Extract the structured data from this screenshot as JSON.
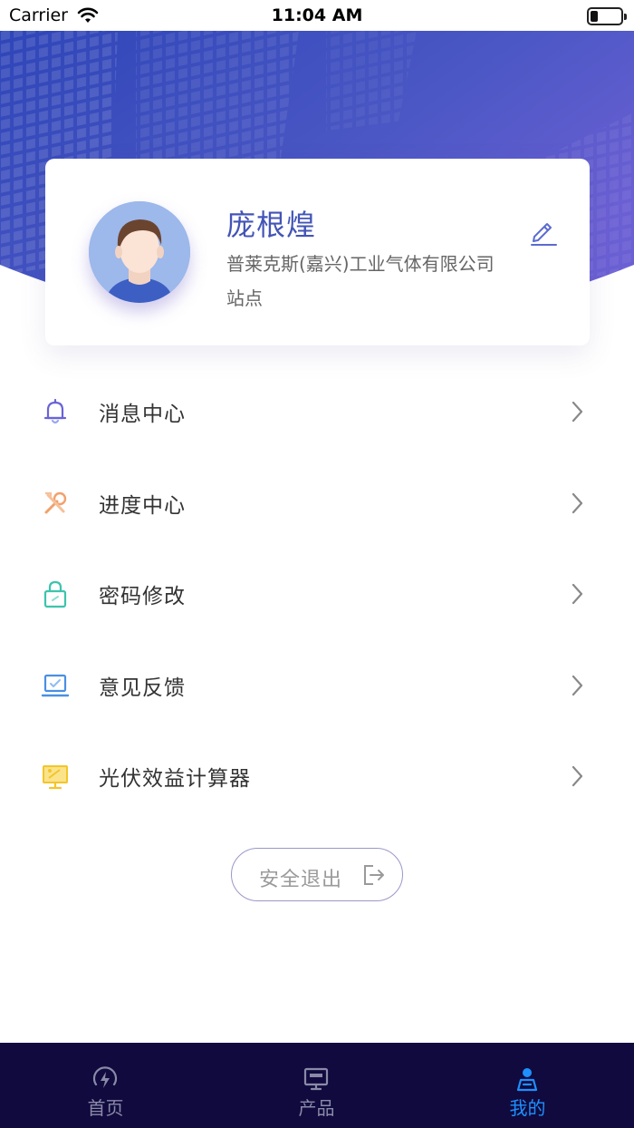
{
  "status_bar": {
    "carrier": "Carrier",
    "time": "11:04 AM",
    "battery_level": 0.25
  },
  "profile": {
    "name": "庞根煌",
    "company": "普莱克斯(嘉兴)工业气体有限公司",
    "role": "站点",
    "avatar_icon": "user-avatar",
    "edit_icon": "pencil-icon"
  },
  "menu": {
    "items": [
      {
        "label": "消息中心",
        "icon": "bell-icon",
        "color": "#6a63d8"
      },
      {
        "label": "进度中心",
        "icon": "wrench-icon",
        "color": "#f2a06b"
      },
      {
        "label": "密码修改",
        "icon": "lock-icon",
        "color": "#3cc4ad"
      },
      {
        "label": "意见反馈",
        "icon": "feedback-laptop-icon",
        "color": "#4a8fe3"
      },
      {
        "label": "光伏效益计算器",
        "icon": "solar-panel-icon",
        "color": "#f4c52a"
      }
    ]
  },
  "logout": {
    "label": "安全退出",
    "icon": "logout-icon"
  },
  "tabbar": {
    "tabs": [
      {
        "label": "首页",
        "icon": "energy-icon",
        "active": false
      },
      {
        "label": "产品",
        "icon": "monitor-icon",
        "active": false
      },
      {
        "label": "我的",
        "icon": "profile-icon",
        "active": true
      }
    ],
    "background": "#100a3e",
    "active_color": "#1e90ff",
    "inactive_color": "#8a8aa8"
  },
  "colors": {
    "accent": "#4354b6",
    "hero_gradient_start": "#2f45b8",
    "hero_gradient_end": "#6a5fd3"
  }
}
